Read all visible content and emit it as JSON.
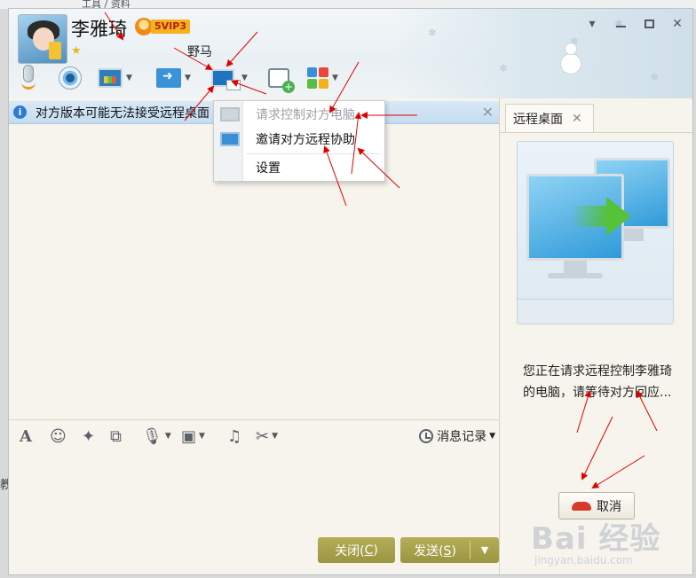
{
  "background": {
    "top_text": "工具 / 资料",
    "left_char": "教"
  },
  "header": {
    "contact_name": "李雅琦",
    "vip_label": "5VIP3",
    "top_annotation": "野马"
  },
  "notice": {
    "text": "对方版本可能无法接受远程桌面"
  },
  "menu": {
    "items": [
      {
        "label": "请求控制对方电脑",
        "enabled": false
      },
      {
        "label": "邀请对方远程协助",
        "enabled": true
      },
      {
        "label": "设置",
        "enabled": true
      }
    ]
  },
  "input_toolbar": {
    "history_label": "消息记录"
  },
  "buttons": {
    "close_label": "关闭(",
    "close_key": "C",
    "close_end": ")",
    "send_label": "发送(",
    "send_key": "S",
    "send_end": ")"
  },
  "side_panel": {
    "tab_label": "远程桌面",
    "waiting_text": "您正在请求远程控制李雅琦的电脑，请等待对方回应...",
    "cancel_label": "取消"
  },
  "watermark": {
    "line1": "Bai 经验",
    "line2": "jingyan.baidu.com"
  },
  "colors": {
    "button_olive": "#a7a04a",
    "notice_blue": "#cfe3f4",
    "annotation_red": "#e00000"
  }
}
